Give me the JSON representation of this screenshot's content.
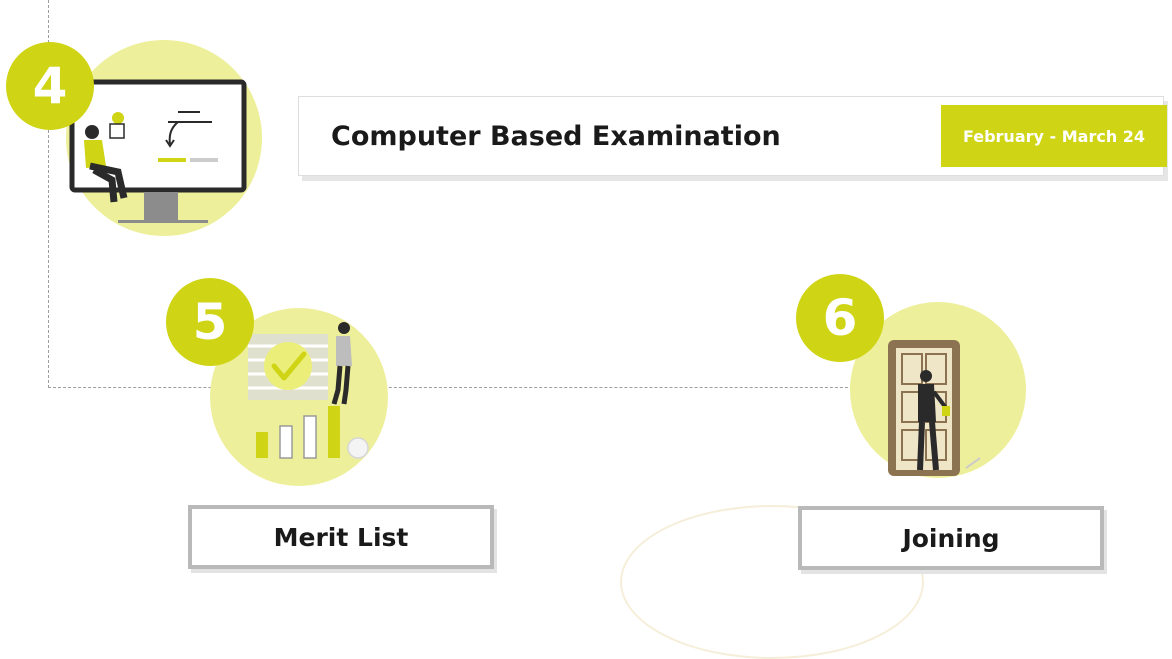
{
  "steps": [
    {
      "number": "4",
      "title": "Computer Based Examination",
      "date": "February - March 24"
    },
    {
      "number": "5",
      "title": "Merit List"
    },
    {
      "number": "6",
      "title": "Joining"
    }
  ],
  "illustrations": [
    "computer-exam-illustration",
    "merit-list-illustration",
    "door-joining-illustration"
  ],
  "colors": {
    "accent": "#cfd414",
    "circle_fill": "#eeef9a",
    "border": "#b9b9b9",
    "text": "#1a1a1a"
  }
}
